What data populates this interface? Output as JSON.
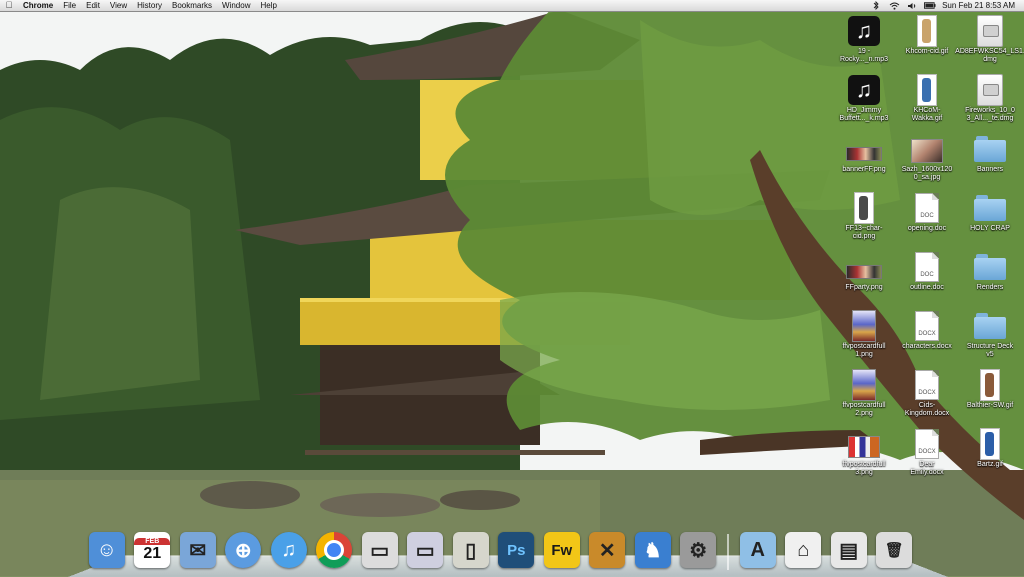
{
  "menubar": {
    "apple_icon": "apple-logo-icon",
    "app_name": "Chrome",
    "menus": [
      "File",
      "Edit",
      "View",
      "History",
      "Bookmarks",
      "Window",
      "Help"
    ],
    "status_icons": [
      "bluetooth-icon",
      "wifi-icon",
      "volume-icon",
      "battery-icon"
    ],
    "clock": "Sun Feb 21  8:53 AM"
  },
  "desktop": {
    "icons": [
      {
        "label": "19 -\nRocky..._n.mp3",
        "icon": "mp3-file-icon",
        "kind": "music"
      },
      {
        "label": "Khcom-cid.gif",
        "icon": "gif-file-icon",
        "kind": "gif",
        "color": "#c9a36b"
      },
      {
        "label": "AD8EFWKSC54_LS1.dmg",
        "icon": "dmg-file-icon",
        "kind": "dmg"
      },
      {
        "label": "HD_Jimmy\nBuffett..._k.mp3",
        "icon": "mp3-file-icon",
        "kind": "music"
      },
      {
        "label": "KHCoM-\nWakka.gif",
        "icon": "gif-file-icon",
        "kind": "gif",
        "color": "#3a6fb0"
      },
      {
        "label": "Fireworks_10_0\n3_All..._te.dmg",
        "icon": "dmg-file-icon",
        "kind": "dmg"
      },
      {
        "label": "bannerFF.png",
        "icon": "png-file-icon",
        "kind": "pngwide"
      },
      {
        "label": "Sazh_1600x120\n0_sa.jpg",
        "icon": "jpg-file-icon",
        "kind": "pngphoto"
      },
      {
        "label": "Banners",
        "icon": "folder-icon",
        "kind": "folder"
      },
      {
        "label": "FF13--char-\ncid.png",
        "icon": "png-file-icon",
        "kind": "gif",
        "color": "#4a4a4a"
      },
      {
        "label": "opening.doc",
        "icon": "doc-file-icon",
        "kind": "doc",
        "ext": "DOC"
      },
      {
        "label": "HOLY CRAP",
        "icon": "folder-icon",
        "kind": "folder"
      },
      {
        "label": "FFparty.png",
        "icon": "png-file-icon",
        "kind": "pngwide"
      },
      {
        "label": "outline.doc",
        "icon": "doc-file-icon",
        "kind": "doc",
        "ext": "DOC"
      },
      {
        "label": "Renders",
        "icon": "folder-icon",
        "kind": "folder"
      },
      {
        "label": "ffvpostcardfull\n1.png",
        "icon": "png-file-icon",
        "kind": "poster"
      },
      {
        "label": "characters.docx",
        "icon": "docx-file-icon",
        "kind": "doc",
        "ext": "DOCX"
      },
      {
        "label": "Structure Deck\nv5",
        "icon": "folder-icon",
        "kind": "folder"
      },
      {
        "label": "ffvpostcardfull\n2.png",
        "icon": "png-file-icon",
        "kind": "poster"
      },
      {
        "label": "Cids-\nKingdom.docx",
        "icon": "docx-file-icon",
        "kind": "doc",
        "ext": "DOCX"
      },
      {
        "label": "Balthier-SW.gif",
        "icon": "gif-file-icon",
        "kind": "gif",
        "color": "#8a5a3a"
      },
      {
        "label": "ffvpostcardfull\n3.png",
        "icon": "png-file-icon",
        "kind": "collage"
      },
      {
        "label": "Dear\nEmily.docx",
        "icon": "docx-file-icon",
        "kind": "doc",
        "ext": "DOCX"
      },
      {
        "label": "Bartz.gif",
        "icon": "gif-file-icon",
        "kind": "gif",
        "color": "#2c5ea8"
      }
    ]
  },
  "dock": {
    "items": [
      {
        "name": "finder",
        "icon": "finder-icon",
        "bg": "#4f8fd8",
        "glyph": "☺"
      },
      {
        "name": "ical",
        "icon": "calendar-icon",
        "bg": "#ffffff",
        "glyph": "21",
        "sub": "FEB"
      },
      {
        "name": "mail",
        "icon": "mail-stamp-icon",
        "bg": "#7aa6d8",
        "glyph": "✉"
      },
      {
        "name": "safari",
        "icon": "safari-compass-icon",
        "bg": "#5b9be0",
        "glyph": "⊕"
      },
      {
        "name": "itunes",
        "icon": "itunes-icon",
        "bg": "#4aa0e8",
        "glyph": "♫"
      },
      {
        "name": "chrome",
        "icon": "chrome-icon",
        "bg": "#e8e8e8",
        "glyph": "◉"
      },
      {
        "name": "nes-emulator",
        "icon": "nes-console-icon",
        "bg": "#dcdcdc",
        "glyph": "▭"
      },
      {
        "name": "snes-emulator",
        "icon": "snes-console-icon",
        "bg": "#cfcfe0",
        "glyph": "▭"
      },
      {
        "name": "gameboy-emulator",
        "icon": "gameboy-icon",
        "bg": "#d6d6cc",
        "glyph": "▯"
      },
      {
        "name": "photoshop",
        "icon": "photoshop-icon",
        "bg": "#1f4e79",
        "glyph": "Ps"
      },
      {
        "name": "fireworks",
        "icon": "fireworks-icon",
        "bg": "#f2c617",
        "glyph": "Fw"
      },
      {
        "name": "game-app",
        "icon": "game-board-icon",
        "bg": "#c98a2a",
        "glyph": "✕"
      },
      {
        "name": "frog-app",
        "icon": "frog-icon",
        "bg": "#3a7fd0",
        "glyph": "♞"
      },
      {
        "name": "system-preferences",
        "icon": "gear-icon",
        "bg": "#9a9a9a",
        "glyph": "⚙"
      },
      {
        "name": "applications-stack",
        "icon": "applications-folder-icon",
        "bg": "#8fbfe6",
        "glyph": "A"
      },
      {
        "name": "home-folder",
        "icon": "home-icon",
        "bg": "#f0f0f0",
        "glyph": "⌂"
      },
      {
        "name": "downloads-stack",
        "icon": "stack-icon",
        "bg": "#e8e8e8",
        "glyph": "▤"
      },
      {
        "name": "trash",
        "icon": "trash-icon",
        "bg": "#dcdcdc",
        "glyph": "🗑"
      }
    ]
  },
  "colors": {
    "label_text": "#ffffff",
    "menubar_bg": "#e8e8e8",
    "pavilion_gold": "#e3c23a",
    "roof": "#5a4a40",
    "pine": "#4d7a2c",
    "water": "#6e7b55"
  }
}
